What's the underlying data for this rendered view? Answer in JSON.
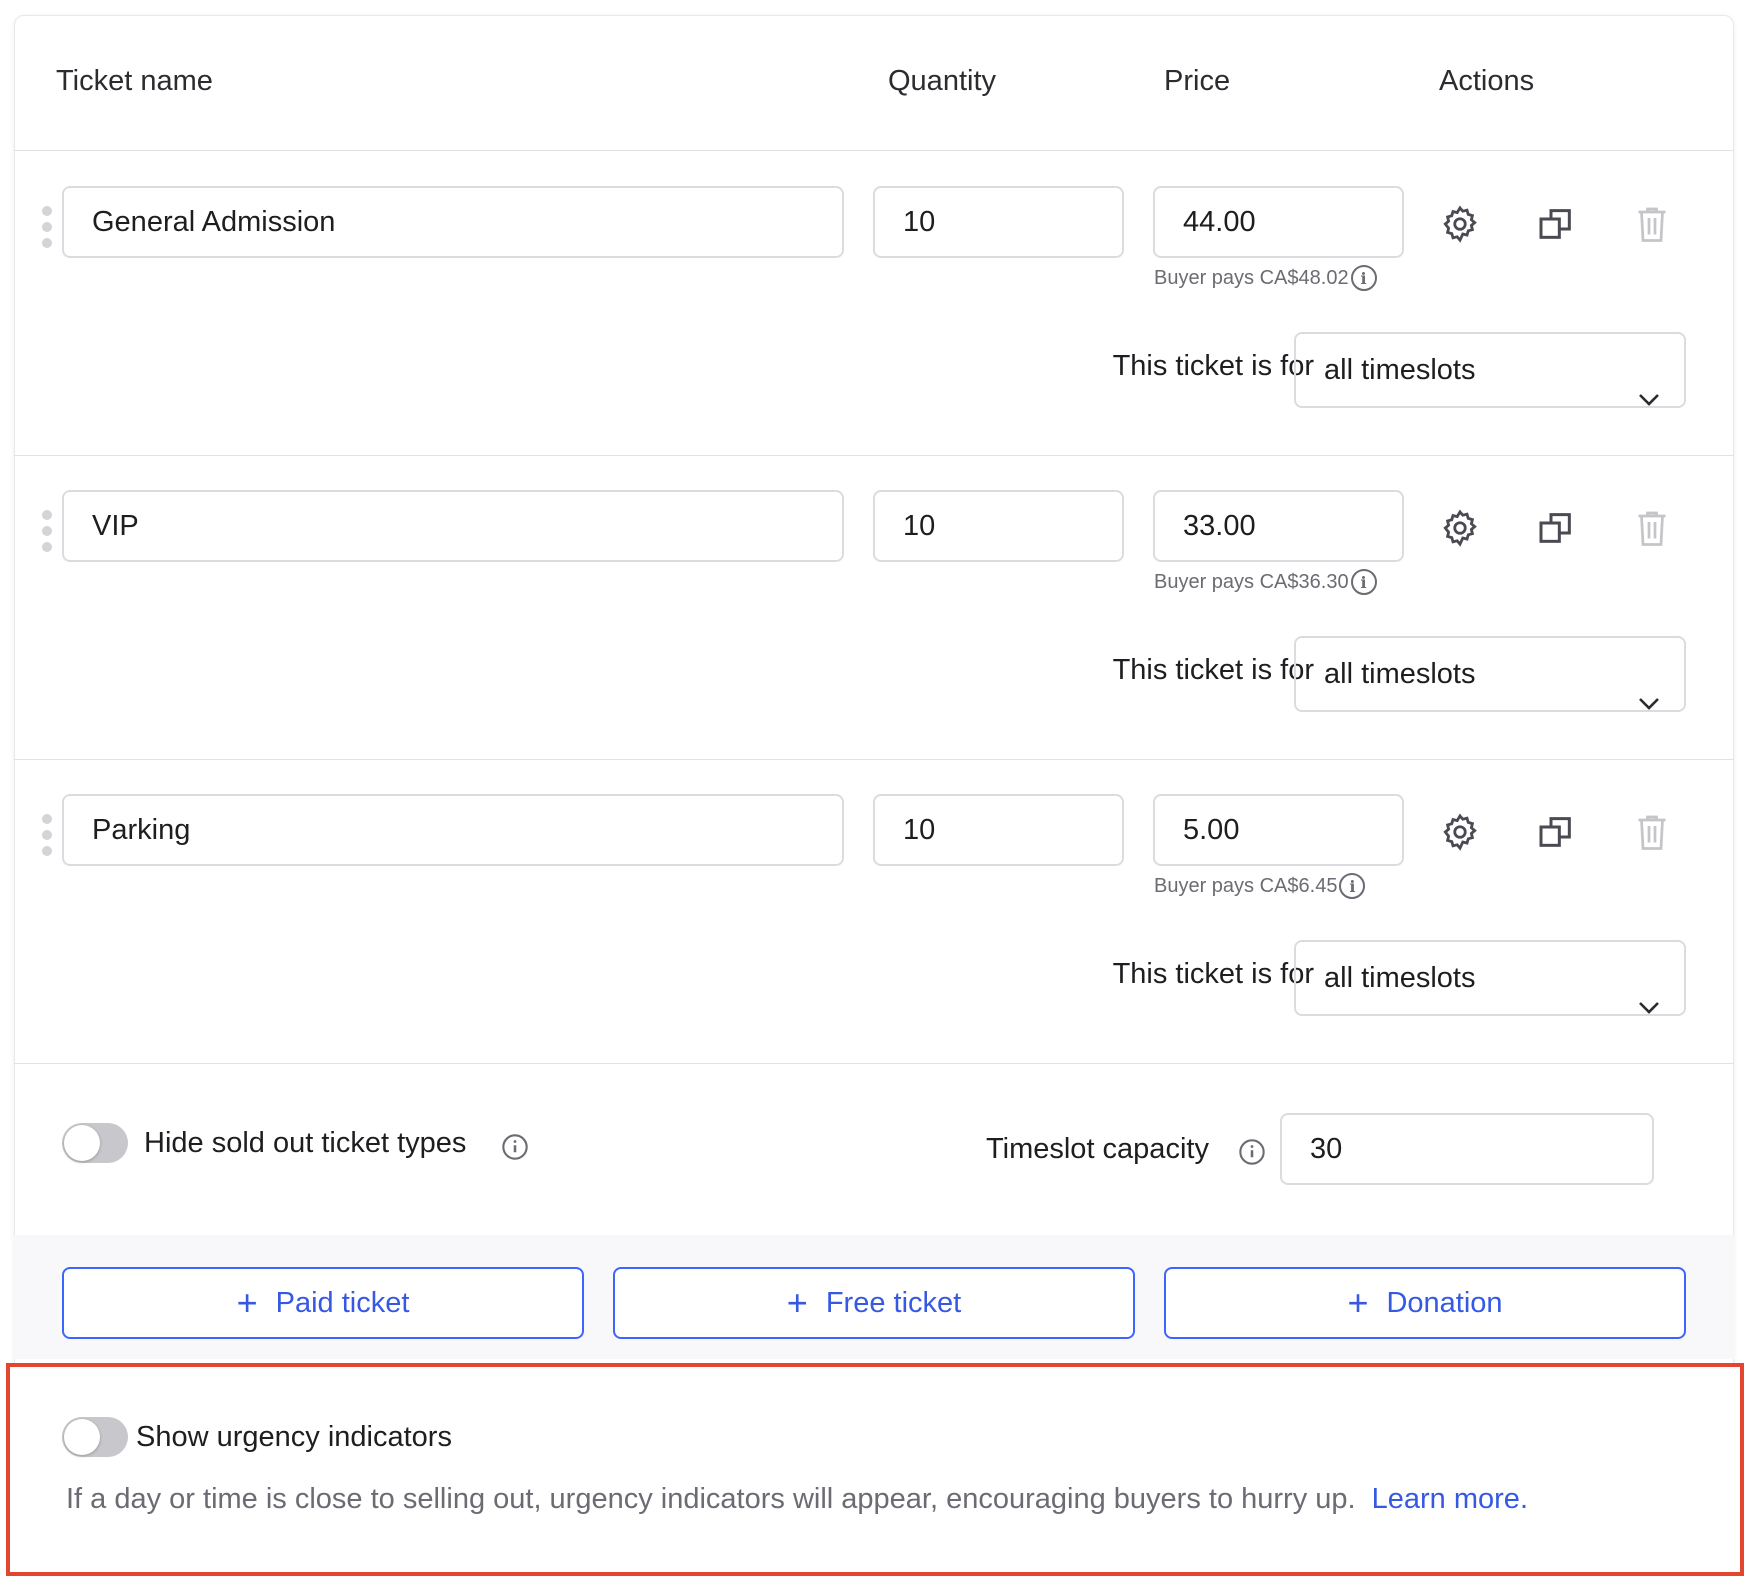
{
  "table_header": {
    "ticket_name": "Ticket name",
    "quantity": "Quantity",
    "price": "Price",
    "actions": "Actions"
  },
  "tickets": [
    {
      "name": "General Admission",
      "quantity": "10",
      "price": "44.00",
      "buyer_pays": "Buyer pays CA$48.02",
      "for_label": "This ticket is for",
      "timeslot": "all timeslots"
    },
    {
      "name": "VIP",
      "quantity": "10",
      "price": "33.00",
      "buyer_pays": "Buyer pays CA$36.30",
      "for_label": "This ticket is for",
      "timeslot": "all timeslots"
    },
    {
      "name": "Parking",
      "quantity": "10",
      "price": "5.00",
      "buyer_pays": "Buyer pays CA$6.45",
      "for_label": "This ticket is for",
      "timeslot": "all timeslots"
    }
  ],
  "settings": {
    "hide_sold_out_label": "Hide sold out ticket types",
    "hide_sold_out_enabled": false,
    "timeslot_capacity_label": "Timeslot capacity",
    "timeslot_capacity_value": "30"
  },
  "add_buttons": {
    "paid": "Paid ticket",
    "free": "Free ticket",
    "donation": "Donation"
  },
  "urgency": {
    "label": "Show urgency indicators",
    "enabled": false,
    "description": "If a day or time is close to selling out, urgency indicators will appear, encouraging buyers to hurry up.",
    "learn_more": "Learn more."
  },
  "colors": {
    "accent": "#3659e3",
    "highlight_border": "#e4452e",
    "toggle_off": "#c8c8cc"
  },
  "icons": [
    "drag-handle-icon",
    "gear-icon",
    "duplicate-icon",
    "trash-icon",
    "info-icon",
    "chevron-down-icon",
    "plus-icon"
  ]
}
